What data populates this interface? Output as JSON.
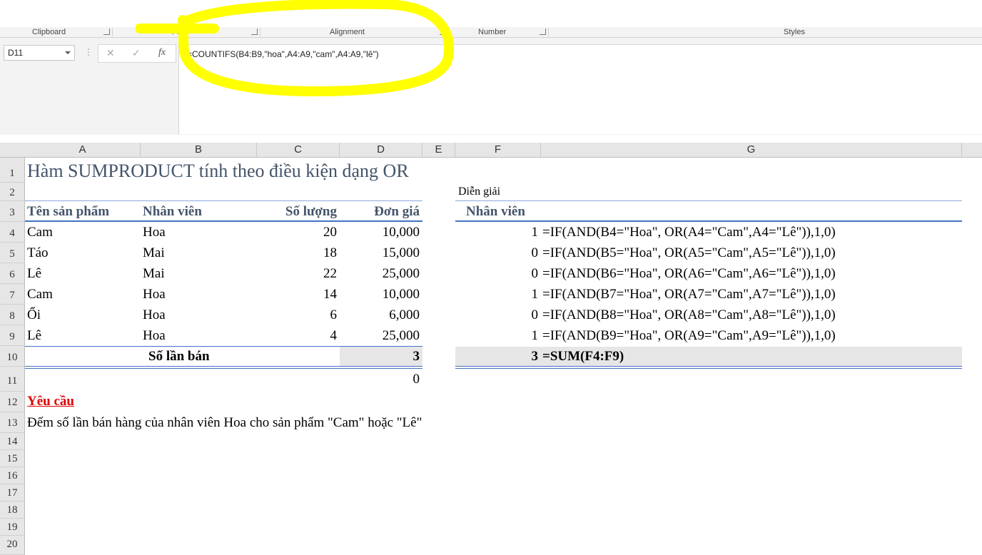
{
  "ribbon": {
    "groups": [
      "Clipboard",
      "Font",
      "Alignment",
      "Number",
      "Styles"
    ]
  },
  "formula_bar": {
    "name_box": "D11",
    "cancel_icon": "✕",
    "enter_icon": "✓",
    "fx_label": "fx",
    "formula": "=COUNTIFS(B4:B9,\"hoa\",A4:A9,\"cam\",A4:A9,\"lê\")"
  },
  "annotation": {
    "color": "#ffff00",
    "shape": "hand-drawn ellipse around formula"
  },
  "columns": [
    "A",
    "B",
    "C",
    "D",
    "E",
    "F",
    "G"
  ],
  "rows": [
    "1",
    "2",
    "3",
    "4",
    "5",
    "6",
    "7",
    "8",
    "9",
    "10",
    "11",
    "12",
    "13",
    "14",
    "15",
    "16",
    "17",
    "18",
    "19",
    "20"
  ],
  "sheet": {
    "title": "Hàm SUMPRODUCT tính theo điều kiện dạng OR",
    "explain_label": "Diễn giải",
    "headers": {
      "product": "Tên sản phẩm",
      "staff": "Nhân viên",
      "qty": "Số lượng",
      "price": "Đơn giá",
      "f_header": "Nhân viên"
    },
    "data": [
      {
        "product": "Cam",
        "staff": "Hoa",
        "qty": "20",
        "price": "10,000",
        "flag": "1",
        "expr": "=IF(AND(B4=\"Hoa\", OR(A4=\"Cam\",A4=\"Lê\")),1,0)"
      },
      {
        "product": "Táo",
        "staff": "Mai",
        "qty": "18",
        "price": "15,000",
        "flag": "0",
        "expr": "=IF(AND(B5=\"Hoa\", OR(A5=\"Cam\",A5=\"Lê\")),1,0)"
      },
      {
        "product": "Lê",
        "staff": "Mai",
        "qty": "22",
        "price": "25,000",
        "flag": "0",
        "expr": "=IF(AND(B6=\"Hoa\", OR(A6=\"Cam\",A6=\"Lê\")),1,0)"
      },
      {
        "product": "Cam",
        "staff": "Hoa",
        "qty": "14",
        "price": "10,000",
        "flag": "1",
        "expr": "=IF(AND(B7=\"Hoa\", OR(A7=\"Cam\",A7=\"Lê\")),1,0)"
      },
      {
        "product": "Ổi",
        "staff": "Hoa",
        "qty": "6",
        "price": "6,000",
        "flag": "0",
        "expr": "=IF(AND(B8=\"Hoa\", OR(A8=\"Cam\",A8=\"Lê\")),1,0)"
      },
      {
        "product": "Lê",
        "staff": "Hoa",
        "qty": "4",
        "price": "25,000",
        "flag": "1",
        "expr": "=IF(AND(B9=\"Hoa\", OR(A9=\"Cam\",A9=\"Lê\")),1,0)"
      }
    ],
    "total_label": "Số lần bán",
    "total_value": "3",
    "f_total": "3",
    "f_total_expr": "=SUM(F4:F9)",
    "d11_value": "0",
    "requirement_title": "Yêu cầu",
    "requirement_text": "Đếm số lần bán hàng của nhân viên Hoa cho sản phẩm \"Cam\" hoặc \"Lê\""
  }
}
